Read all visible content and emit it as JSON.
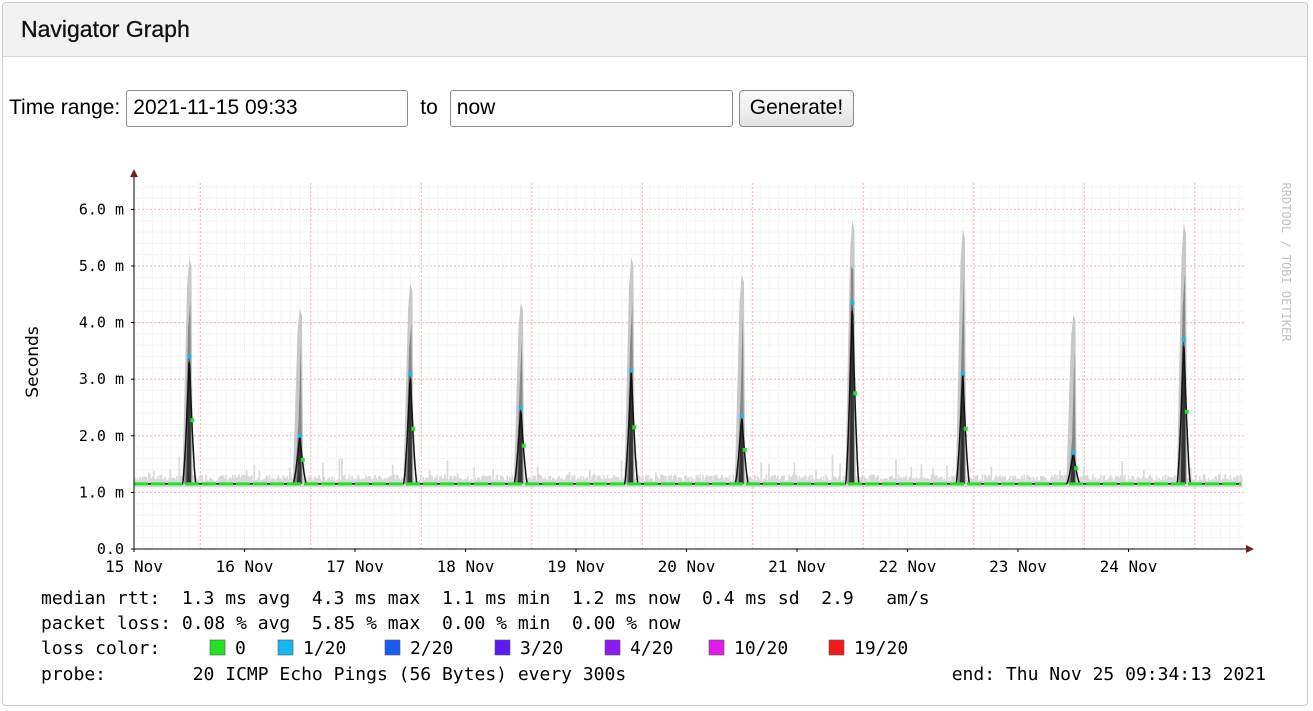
{
  "panel": {
    "title": "Navigator Graph"
  },
  "controls": {
    "time_range_label": "Time range:",
    "from_value": "2021-11-15 09:33",
    "to_label": "to",
    "to_value": "now",
    "generate_label": "Generate!"
  },
  "chart_data": {
    "type": "line",
    "ylabel": "Seconds",
    "watermark": "RRDTOOL / TOBI OETIKER",
    "ylim": [
      0,
      6.5
    ],
    "y_ticks": [
      {
        "value": 0.0,
        "label": "0.0"
      },
      {
        "value": 1.0,
        "label": "1.0 m"
      },
      {
        "value": 2.0,
        "label": "2.0 m"
      },
      {
        "value": 3.0,
        "label": "3.0 m"
      },
      {
        "value": 4.0,
        "label": "4.0 m"
      },
      {
        "value": 5.0,
        "label": "5.0 m"
      },
      {
        "value": 6.0,
        "label": "6.0 m"
      }
    ],
    "x_ticks": [
      "15 Nov",
      "16 Nov",
      "17 Nov",
      "18 Nov",
      "19 Nov",
      "20 Nov",
      "21 Nov",
      "22 Nov",
      "23 Nov",
      "24 Nov"
    ],
    "xlim_days": [
      0,
      10.05
    ],
    "grid": true,
    "baseline_ms": 1.15,
    "spikes": [
      {
        "day": 0.5,
        "median_ms": 3.4,
        "max_ms": 5.15
      },
      {
        "day": 1.5,
        "median_ms": 2.0,
        "max_ms": 4.25
      },
      {
        "day": 2.5,
        "median_ms": 3.1,
        "max_ms": 4.7
      },
      {
        "day": 3.5,
        "median_ms": 2.5,
        "max_ms": 4.35
      },
      {
        "day": 4.5,
        "median_ms": 3.15,
        "max_ms": 5.15
      },
      {
        "day": 5.5,
        "median_ms": 2.35,
        "max_ms": 4.85
      },
      {
        "day": 6.5,
        "median_ms": 4.35,
        "max_ms": 5.8
      },
      {
        "day": 7.5,
        "median_ms": 3.1,
        "max_ms": 5.65
      },
      {
        "day": 8.5,
        "median_ms": 1.7,
        "max_ms": 4.15
      },
      {
        "day": 9.5,
        "median_ms": 3.7,
        "max_ms": 5.75
      }
    ],
    "legend_lines": [
      "median rtt:  1.3 ms avg  4.3 ms max  1.1 ms min  1.2 ms now  0.4 ms sd  2.9   am/s",
      "packet loss: 0.08 % avg  5.85 % max  0.00 % min  0.00 % now"
    ],
    "loss_color_label": "loss color:",
    "loss_colors": [
      {
        "label": "0",
        "color": "#26e026"
      },
      {
        "label": "1/20",
        "color": "#19b6f2"
      },
      {
        "label": "2/20",
        "color": "#1a5cf0"
      },
      {
        "label": "3/20",
        "color": "#5a1cf0"
      },
      {
        "label": "4/20",
        "color": "#8a1cf0"
      },
      {
        "label": "10/20",
        "color": "#e01ce8"
      },
      {
        "label": "19/20",
        "color": "#f01c1c"
      }
    ],
    "probe_text": "probe:        20 ICMP Echo Pings (56 Bytes) every 300s",
    "end_text": "end: Thu Nov 25 09:34:13 2021"
  }
}
